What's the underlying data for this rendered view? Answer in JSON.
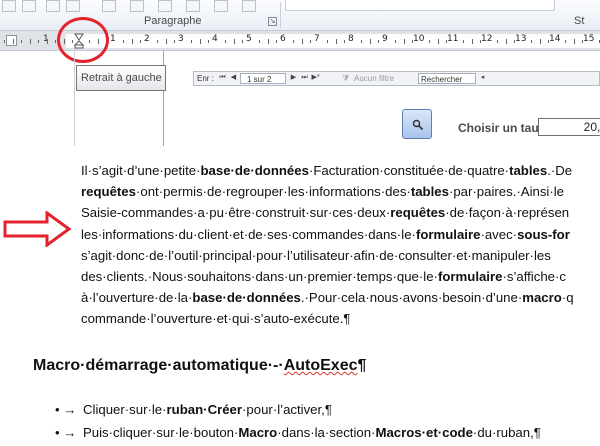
{
  "ribbon": {
    "group_label": "Paragraphe",
    "styles_label": "St"
  },
  "ruler": {
    "numbers": [
      "1",
      "1",
      "2",
      "3",
      "4",
      "5",
      "6",
      "7",
      "8",
      "9",
      "10",
      "11",
      "12",
      "13",
      "14",
      "15"
    ]
  },
  "tooltip": {
    "text": "Retrait à gauche"
  },
  "record_nav": {
    "label": "Enr :",
    "position": "1 sur 2",
    "filter": "Aucun filtre",
    "search": "Rechercher"
  },
  "form": {
    "rate_label": "Choisir un taux",
    "rate_value": "20,0"
  },
  "document": {
    "paragraph_lines": [
      [
        {
          "t": "Il·s’agit·d’une·petite·"
        },
        {
          "t": "base·de·données",
          "b": true
        },
        {
          "t": "·Facturation·constituée·de·quatre·"
        },
        {
          "t": "tables",
          "b": true
        },
        {
          "t": ".·De"
        }
      ],
      [
        {
          "t": "requêtes",
          "b": true
        },
        {
          "t": "·ont·permis·de·regrouper·les·informations·des·"
        },
        {
          "t": "tables",
          "b": true
        },
        {
          "t": "·par·paires.·Ainsi·le"
        }
      ],
      [
        {
          "t": "Saisie-commandes·a·pu·être·construit·sur·ces·deux·"
        },
        {
          "t": "requêtes",
          "b": true
        },
        {
          "t": "·de·façon·à·représen"
        }
      ],
      [
        {
          "t": "les·informations·du·client·et·de·ses·commandes·dans·le·"
        },
        {
          "t": "formulaire",
          "b": true
        },
        {
          "t": "·avec·"
        },
        {
          "t": "sous-for",
          "b": true
        }
      ],
      [
        {
          "t": "s’agit·donc·de·l’outil·principal·pour·l’utilisateur·afin·de·consulter·et·manipuler·les"
        }
      ],
      [
        {
          "t": "des·clients.·Nous·souhaitons·dans·un·premier·temps·que·le·"
        },
        {
          "t": "formulaire",
          "b": true
        },
        {
          "t": "·s’affiche·c"
        }
      ],
      [
        {
          "t": "à·l’ouverture·de·la·"
        },
        {
          "t": "base·de·données",
          "b": true
        },
        {
          "t": ".·Pour·cela·nous·avons·besoin·d’une·"
        },
        {
          "t": "macro",
          "b": true
        },
        {
          "t": "·q"
        }
      ],
      [
        {
          "t": "commande·l’ouverture·et·qui·s’auto-exécute.¶"
        }
      ]
    ],
    "heading_prefix": "Macro·démarrage·automatique·-·",
    "heading_keyword": "AutoExec",
    "heading_suffix": "¶",
    "bullets": [
      [
        {
          "t": "Cliquer·sur·le·"
        },
        {
          "t": "ruban·Créer",
          "b": true
        },
        {
          "t": "·pour·l’activer,¶"
        }
      ],
      [
        {
          "t": "Puis·cliquer·sur·le·bouton·"
        },
        {
          "t": "Macro",
          "b": true
        },
        {
          "t": "·dans·la·section·"
        },
        {
          "t": "Macros·et·code",
          "b": true
        },
        {
          "t": "·du·ruban,¶"
        }
      ]
    ],
    "bullet_glyph": "•",
    "tab_glyph": "→"
  },
  "colors": {
    "annotation_red": "#e3222b",
    "ruler_gray": "#dfe3e8"
  },
  "icons": {
    "search_button": "magnifier-icon",
    "callout_arrow": "arrow-right-icon",
    "indent_marker": "hourglass-indent-icon"
  }
}
